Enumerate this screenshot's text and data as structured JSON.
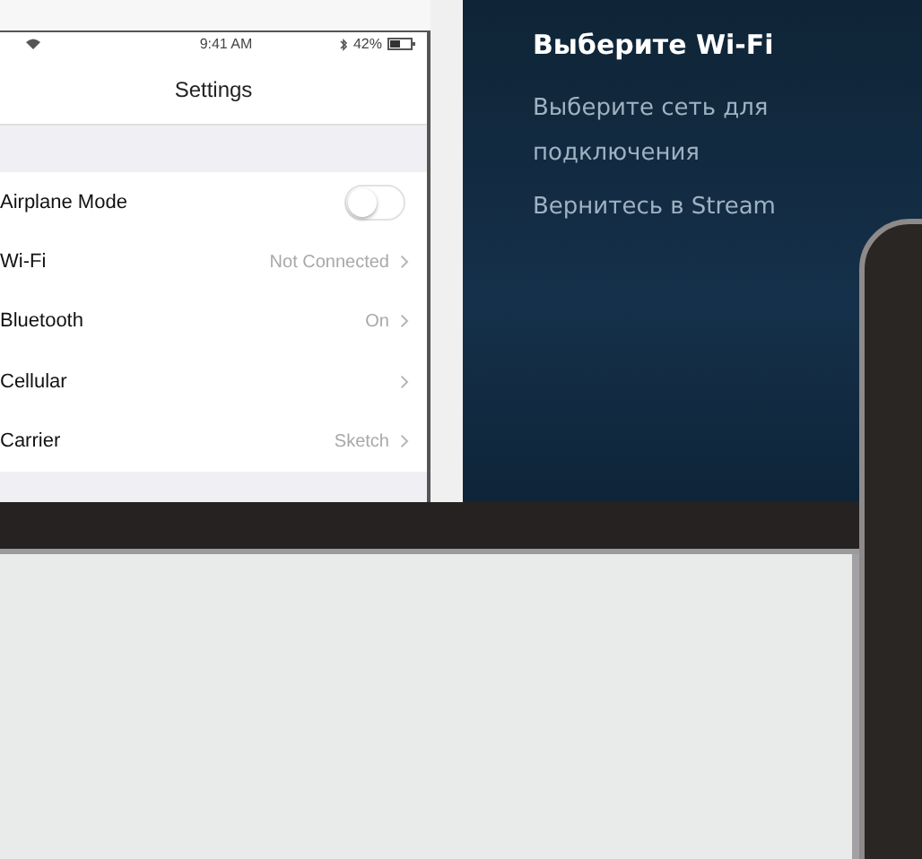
{
  "phone_settings": {
    "status_bar": {
      "time": "9:41 AM",
      "battery": "42%"
    },
    "title": "Settings",
    "rows": [
      {
        "kind": "toggle",
        "label": "Airplane Mode",
        "on": false
      },
      {
        "kind": "link",
        "label": "Wi-Fi",
        "value": "Not Connected"
      },
      {
        "kind": "link",
        "label": "Bluetooth",
        "value": "On"
      },
      {
        "kind": "link",
        "label": "Cellular"
      },
      {
        "kind": "link",
        "label": "Carrier",
        "value": "Sketch"
      }
    ]
  },
  "wifi_panel": {
    "title": "Выберите Wi-Fi",
    "subtitle": "Выберите сеть для подключения",
    "instruction": "Вернитесь в Stream"
  }
}
